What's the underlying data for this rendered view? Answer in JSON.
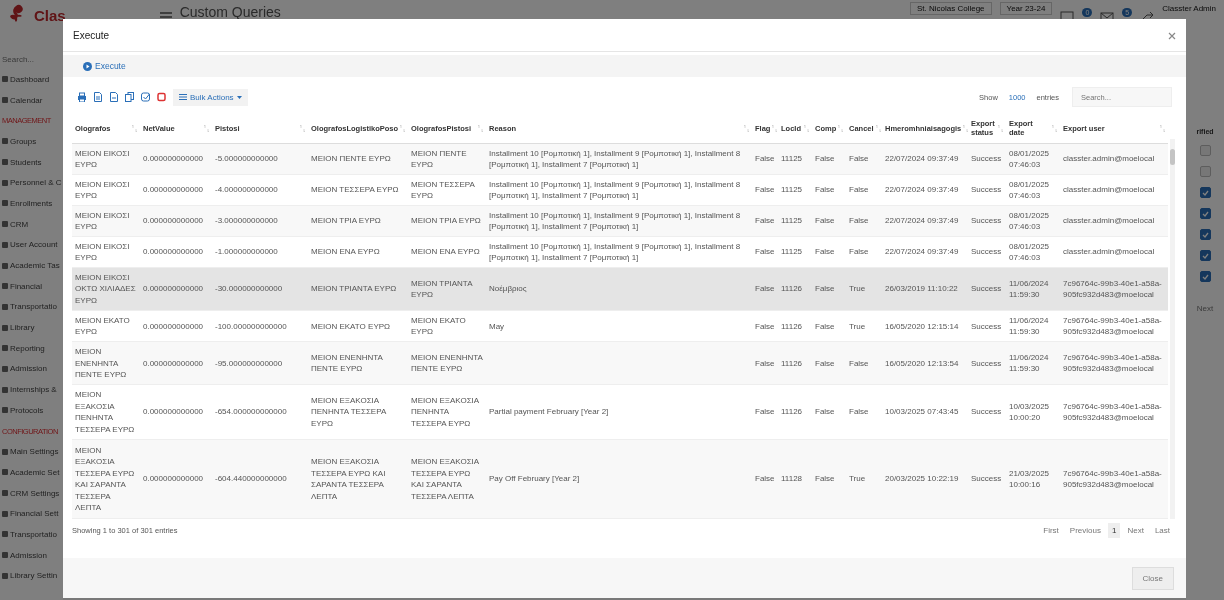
{
  "background": {
    "logo": "Clas",
    "page_title": "Custom Queries",
    "school": "St. Nicolas College",
    "year": "Year 23-24",
    "badges": [
      "0",
      "5"
    ],
    "user": "Classter Admin",
    "sidebar": {
      "search_placeholder": "Search...",
      "items": [
        {
          "kind": "item",
          "label": "Dashboard"
        },
        {
          "kind": "item",
          "label": "Calendar"
        },
        {
          "kind": "section",
          "label": "MANAGEMENT"
        },
        {
          "kind": "item",
          "label": "Groups"
        },
        {
          "kind": "item",
          "label": "Students"
        },
        {
          "kind": "item",
          "label": "Personnel & C"
        },
        {
          "kind": "item",
          "label": "Enrollments"
        },
        {
          "kind": "item",
          "label": "CRM"
        },
        {
          "kind": "item",
          "label": "User Account"
        },
        {
          "kind": "item",
          "label": "Academic Tas"
        },
        {
          "kind": "item",
          "label": "Financial"
        },
        {
          "kind": "item",
          "label": "Transportatio"
        },
        {
          "kind": "item",
          "label": "Library"
        },
        {
          "kind": "item",
          "label": "Reporting"
        },
        {
          "kind": "item",
          "label": "Admission"
        },
        {
          "kind": "item",
          "label": "Internships &"
        },
        {
          "kind": "item",
          "label": "Protocols"
        },
        {
          "kind": "section",
          "label": "CONFIGURATION"
        },
        {
          "kind": "item",
          "label": "Main Settings"
        },
        {
          "kind": "item",
          "label": "Academic Set"
        },
        {
          "kind": "item",
          "label": "CRM Settings"
        },
        {
          "kind": "item",
          "label": "Financial Sett"
        },
        {
          "kind": "item",
          "label": "Transportatio"
        },
        {
          "kind": "item",
          "label": "Admission"
        },
        {
          "kind": "item",
          "label": "Library Settin"
        }
      ]
    },
    "right_column": {
      "header": "rified",
      "checkboxes": [
        {
          "checked": false
        },
        {
          "checked": false
        },
        {
          "checked": true
        },
        {
          "checked": true
        },
        {
          "checked": true
        },
        {
          "checked": true
        },
        {
          "checked": true
        }
      ],
      "next": "Next"
    }
  },
  "modal": {
    "title": "Execute",
    "execute_button": "Execute",
    "toolbar": {
      "bulk_actions": "Bulk Actions"
    },
    "show_label": "Show",
    "page_length": "1000",
    "entries_label": "entries",
    "search_placeholder": "Search...",
    "table": {
      "columns": [
        "Olografos",
        "NetValue",
        "Pistosi",
        "OlografosLogistikoPoso",
        "OlografosPistosi",
        "Reason",
        "Flag",
        "LocId",
        "Comp",
        "Cancel",
        "Hmeromhniaisagogis",
        "Export status",
        "Export date",
        "Export user"
      ],
      "rows": [
        {
          "highlighted": false,
          "cells": [
            "ΜΕΙΟΝ ΕΙΚΟΣΙ ΕΥΡΩ",
            "0.000000000000",
            "-5.000000000000",
            "ΜΕΙΟΝ ΠΕΝΤΕ ΕΥΡΩ",
            "ΜΕΙΟΝ ΠΕΝΤΕ ΕΥΡΩ",
            "Installment 10 [Ρομποτική 1], Installment 9 [Ρομποτική 1], Installment 8 [Ρομποτική 1], Installment 7 [Ρομποτική 1]",
            "False",
            "11125",
            "False",
            "False",
            "22/07/2024 09:37:49",
            "Success",
            "08/01/2025 07:46:03",
            "classter.admin@moelocal"
          ]
        },
        {
          "highlighted": false,
          "cells": [
            "ΜΕΙΟΝ ΕΙΚΟΣΙ ΕΥΡΩ",
            "0.000000000000",
            "-4.000000000000",
            "ΜΕΙΟΝ ΤΕΣΣΕΡΑ ΕΥΡΩ",
            "ΜΕΙΟΝ ΤΕΣΣΕΡΑ ΕΥΡΩ",
            "Installment 10 [Ρομποτική 1], Installment 9 [Ρομποτική 1], Installment 8 [Ρομποτική 1], Installment 7 [Ρομποτική 1]",
            "False",
            "11125",
            "False",
            "False",
            "22/07/2024 09:37:49",
            "Success",
            "08/01/2025 07:46:03",
            "classter.admin@moelocal"
          ]
        },
        {
          "highlighted": false,
          "cells": [
            "ΜΕΙΟΝ ΕΙΚΟΣΙ ΕΥΡΩ",
            "0.000000000000",
            "-3.000000000000",
            "ΜΕΙΟΝ ΤΡΙΑ ΕΥΡΩ",
            "ΜΕΙΟΝ ΤΡΙΑ ΕΥΡΩ",
            "Installment 10 [Ρομποτική 1], Installment 9 [Ρομποτική 1], Installment 8 [Ρομποτική 1], Installment 7 [Ρομποτική 1]",
            "False",
            "11125",
            "False",
            "False",
            "22/07/2024 09:37:49",
            "Success",
            "08/01/2025 07:46:03",
            "classter.admin@moelocal"
          ]
        },
        {
          "highlighted": false,
          "cells": [
            "ΜΕΙΟΝ ΕΙΚΟΣΙ ΕΥΡΩ",
            "0.000000000000",
            "-1.000000000000",
            "ΜΕΙΟΝ ΕΝΑ ΕΥΡΩ",
            "ΜΕΙΟΝ ΕΝΑ ΕΥΡΩ",
            "Installment 10 [Ρομποτική 1], Installment 9 [Ρομποτική 1], Installment 8 [Ρομποτική 1], Installment 7 [Ρομποτική 1]",
            "False",
            "11125",
            "False",
            "False",
            "22/07/2024 09:37:49",
            "Success",
            "08/01/2025 07:46:03",
            "classter.admin@moelocal"
          ]
        },
        {
          "highlighted": true,
          "cells": [
            "ΜΕΙΟΝ ΕΙΚΟΣΙ ΟΚΤΩ ΧΙΛΙΑΔΕΣ ΕΥΡΩ",
            "0.000000000000",
            "-30.000000000000",
            "ΜΕΙΟΝ ΤΡΙΑΝΤΑ ΕΥΡΩ",
            "ΜΕΙΟΝ ΤΡΙΑΝΤΑ ΕΥΡΩ",
            "Νοέμβριος",
            "False",
            "11126",
            "False",
            "True",
            "26/03/2019 11:10:22",
            "Success",
            "11/06/2024 11:59:30",
            "7c96764c-99b3-40e1-a58a-905fc932d483@moelocal"
          ]
        },
        {
          "highlighted": false,
          "cells": [
            "ΜΕΙΟΝ ΕΚΑΤΟ ΕΥΡΩ",
            "0.000000000000",
            "-100.000000000000",
            "ΜΕΙΟΝ ΕΚΑΤΟ ΕΥΡΩ",
            "ΜΕΙΟΝ ΕΚΑΤΟ ΕΥΡΩ",
            "May",
            "False",
            "11126",
            "False",
            "True",
            "16/05/2020 12:15:14",
            "Success",
            "11/06/2024 11:59:30",
            "7c96764c-99b3-40e1-a58a-905fc932d483@moelocal"
          ]
        },
        {
          "highlighted": false,
          "cells": [
            "ΜΕΙΟΝ ΕΝΕΝΗΝΤΑ ΠΕΝΤΕ ΕΥΡΩ",
            "0.000000000000",
            "-95.000000000000",
            "ΜΕΙΟΝ ΕΝΕΝΗΝΤΑ ΠΕΝΤΕ ΕΥΡΩ",
            "ΜΕΙΟΝ ΕΝΕΝΗΝΤΑ ΠΕΝΤΕ ΕΥΡΩ",
            null,
            "False",
            "11126",
            "False",
            "False",
            "16/05/2020 12:13:54",
            "Success",
            "11/06/2024 11:59:30",
            "7c96764c-99b3-40e1-a58a-905fc932d483@moelocal"
          ]
        },
        {
          "highlighted": false,
          "cells": [
            "ΜΕΙΟΝ ΕΞΑΚΟΣΙΑ ΠΕΝΗΝΤΑ ΤΕΣΣΕΡΑ ΕΥΡΩ",
            "0.000000000000",
            "-654.000000000000",
            "ΜΕΙΟΝ ΕΞΑΚΟΣΙΑ ΠΕΝΗΝΤΑ ΤΕΣΣΕΡΑ ΕΥΡΩ",
            "ΜΕΙΟΝ ΕΞΑΚΟΣΙΑ ΠΕΝΗΝΤΑ ΤΕΣΣΕΡΑ ΕΥΡΩ",
            "Partial payment February [Year 2]",
            "False",
            "11126",
            "False",
            "False",
            "10/03/2025 07:43:45",
            "Success",
            "10/03/2025 10:00:20",
            "7c96764c-99b3-40e1-a58a-905fc932d483@moelocal"
          ]
        },
        {
          "highlighted": false,
          "cells": [
            "ΜΕΙΟΝ ΕΞΑΚΟΣΙΑ ΤΕΣΣΕΡΑ ΕΥΡΩ ΚΑΙ ΣΑΡΑΝΤΑ ΤΕΣΣΕΡΑ ΛΕΠΤΑ",
            "0.000000000000",
            "-604.440000000000",
            "ΜΕΙΟΝ ΕΞΑΚΟΣΙΑ ΤΕΣΣΕΡΑ ΕΥΡΩ ΚΑΙ ΣΑΡΑΝΤΑ ΤΕΣΣΕΡΑ ΛΕΠΤΑ",
            "ΜΕΙΟΝ ΕΞΑΚΟΣΙΑ ΤΕΣΣΕΡΑ ΕΥΡΩ ΚΑΙ ΣΑΡΑΝΤΑ ΤΕΣΣΕΡΑ ΛΕΠΤΑ",
            "Pay Off February [Year 2]",
            "False",
            "11128",
            "False",
            "True",
            "20/03/2025 10:22:19",
            "Success",
            "21/03/2025 10:00:16",
            "7c96764c-99b3-40e1-a58a-905fc932d483@moelocal"
          ]
        }
      ]
    },
    "info": "Showing 1 to 301 of 301 entries",
    "pagination": [
      {
        "label": "First",
        "selected": false
      },
      {
        "label": "Previous",
        "selected": false
      },
      {
        "label": "1",
        "selected": true
      },
      {
        "label": "Next",
        "selected": false
      },
      {
        "label": "Last",
        "selected": false
      }
    ],
    "close_button": "Close"
  }
}
